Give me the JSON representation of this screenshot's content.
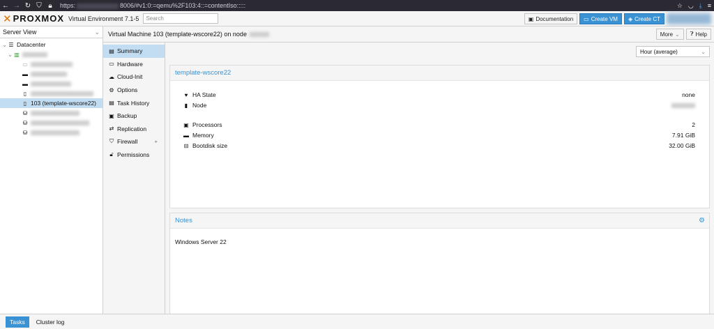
{
  "browser": {
    "url_prefix": "https:",
    "url_suffix": "8006/#v1:0:=qemu%2F103:4::=contentIso:::::"
  },
  "header": {
    "logo_text": "PROXMOX",
    "version": "Virtual Environment 7.1-5",
    "search_placeholder": "Search",
    "documentation_label": "Documentation",
    "create_vm_label": "Create VM",
    "create_ct_label": "Create CT"
  },
  "tree": {
    "view_label": "Server View",
    "datacenter_label": "Datacenter",
    "selected_vm_label": "103 (template-wscore22)"
  },
  "content_header": {
    "title": "Virtual Machine 103 (template-wscore22) on node",
    "more_label": "More",
    "help_label": "Help"
  },
  "nav": {
    "items": [
      {
        "label": "Summary",
        "icon": "book-icon"
      },
      {
        "label": "Hardware",
        "icon": "monitor-icon"
      },
      {
        "label": "Cloud-Init",
        "icon": "cloud-icon"
      },
      {
        "label": "Options",
        "icon": "gear-icon"
      },
      {
        "label": "Task History",
        "icon": "list-icon"
      },
      {
        "label": "Backup",
        "icon": "floppy-icon"
      },
      {
        "label": "Replication",
        "icon": "retweet-icon"
      },
      {
        "label": "Firewall",
        "icon": "shield-icon"
      },
      {
        "label": "Permissions",
        "icon": "unlock-icon"
      }
    ]
  },
  "summary": {
    "timeframe": "Hour (average)",
    "panel_title": "template-wscore22",
    "ha_state_label": "HA State",
    "ha_state_value": "none",
    "node_label": "Node",
    "processors_label": "Processors",
    "processors_value": "2",
    "memory_label": "Memory",
    "memory_value": "7.91 GiB",
    "bootdisk_label": "Bootdisk size",
    "bootdisk_value": "32.00 GiB"
  },
  "notes": {
    "title": "Notes",
    "text": "Windows Server 22"
  },
  "bottom": {
    "tasks_label": "Tasks",
    "cluster_log_label": "Cluster log"
  },
  "colors": {
    "accent": "#3892d4",
    "brand": "#e57000",
    "selection": "#c2ddf2"
  }
}
